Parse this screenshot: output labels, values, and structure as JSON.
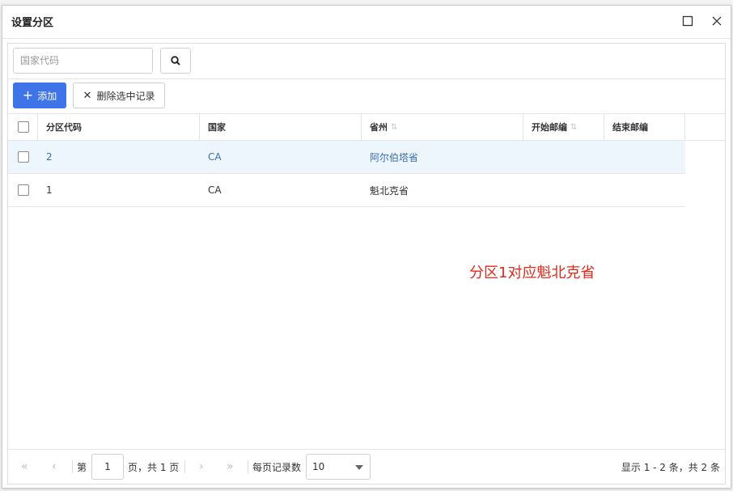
{
  "dialog": {
    "title": "设置分区"
  },
  "search": {
    "placeholder": "国家代码",
    "value": ""
  },
  "toolbar": {
    "add_label": "添加",
    "delete_label": "删除选中记录"
  },
  "table": {
    "columns": [
      "分区代码",
      "国家",
      "省州",
      "开始邮编",
      "结束邮编"
    ],
    "rows": [
      {
        "code": "2",
        "country": "CA",
        "province": "阿尔伯塔省",
        "start": "",
        "end": "",
        "selected": true
      },
      {
        "code": "1",
        "country": "CA",
        "province": "魁北克省",
        "start": "",
        "end": "",
        "selected": false
      }
    ]
  },
  "annotation": "分区1对应魁北克省",
  "pager": {
    "page_prefix": "第",
    "page_value": "1",
    "page_suffix": "页，共 1 页",
    "page_size_label": "每页记录数",
    "page_size_value": "10",
    "record_info": "显示 1 - 2 条，共 2 条"
  },
  "colors": {
    "accent": "#3f73e8",
    "selected_row_bg": "#eef6fd",
    "selected_text": "#3a6db3",
    "annotation": "#e02a1b"
  }
}
